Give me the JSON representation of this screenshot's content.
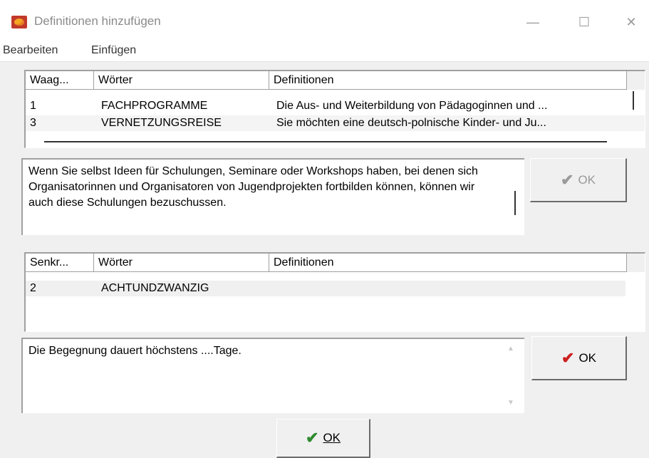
{
  "window": {
    "title": "Definitionen hinzufügen",
    "min_glyph": "—",
    "max_glyph": "☐",
    "close_glyph": "✕"
  },
  "menu": {
    "edit": "Bearbeiten",
    "insert": "Einfügen"
  },
  "across_table": {
    "columns": [
      "Waag...",
      "Wörter",
      "Definitionen"
    ],
    "rows": [
      {
        "num": "1",
        "word": "FACHPROGRAMME",
        "definition": "Die Aus- und Weiterbildung von Pädagoginnen und ..."
      },
      {
        "num": "3",
        "word": "VERNETZUNGSREISE",
        "definition": "Sie möchten eine deutsch-polnische Kinder- und Ju..."
      }
    ]
  },
  "across_definition": {
    "text": "Wenn Sie selbst Ideen für Schulungen, Seminare oder Workshops haben, bei denen sich Organisatorinnen und Organisatoren von Jugendprojekten fortbilden können, können wir auch diese Schulungen bezuschussen."
  },
  "across_ok": {
    "label": "OK",
    "icon": "checkmark-icon",
    "enabled": false,
    "color": "#9a9a9a"
  },
  "down_table": {
    "columns": [
      "Senkr...",
      "Wörter",
      "Definitionen"
    ],
    "rows": [
      {
        "num": "2",
        "word": "ACHTUNDZWANZIG",
        "definition": ""
      }
    ]
  },
  "down_definition": {
    "text": "Die Begegnung dauert höchstens ....Tage."
  },
  "down_ok": {
    "label": "OK",
    "icon": "checkmark-icon",
    "enabled": true,
    "color": "#cc1f1f"
  },
  "main_ok": {
    "label": "OK",
    "icon": "checkmark-icon",
    "color": "#2e8b2e"
  },
  "scroll_arrows": {
    "up": "▲",
    "down": "▼"
  }
}
